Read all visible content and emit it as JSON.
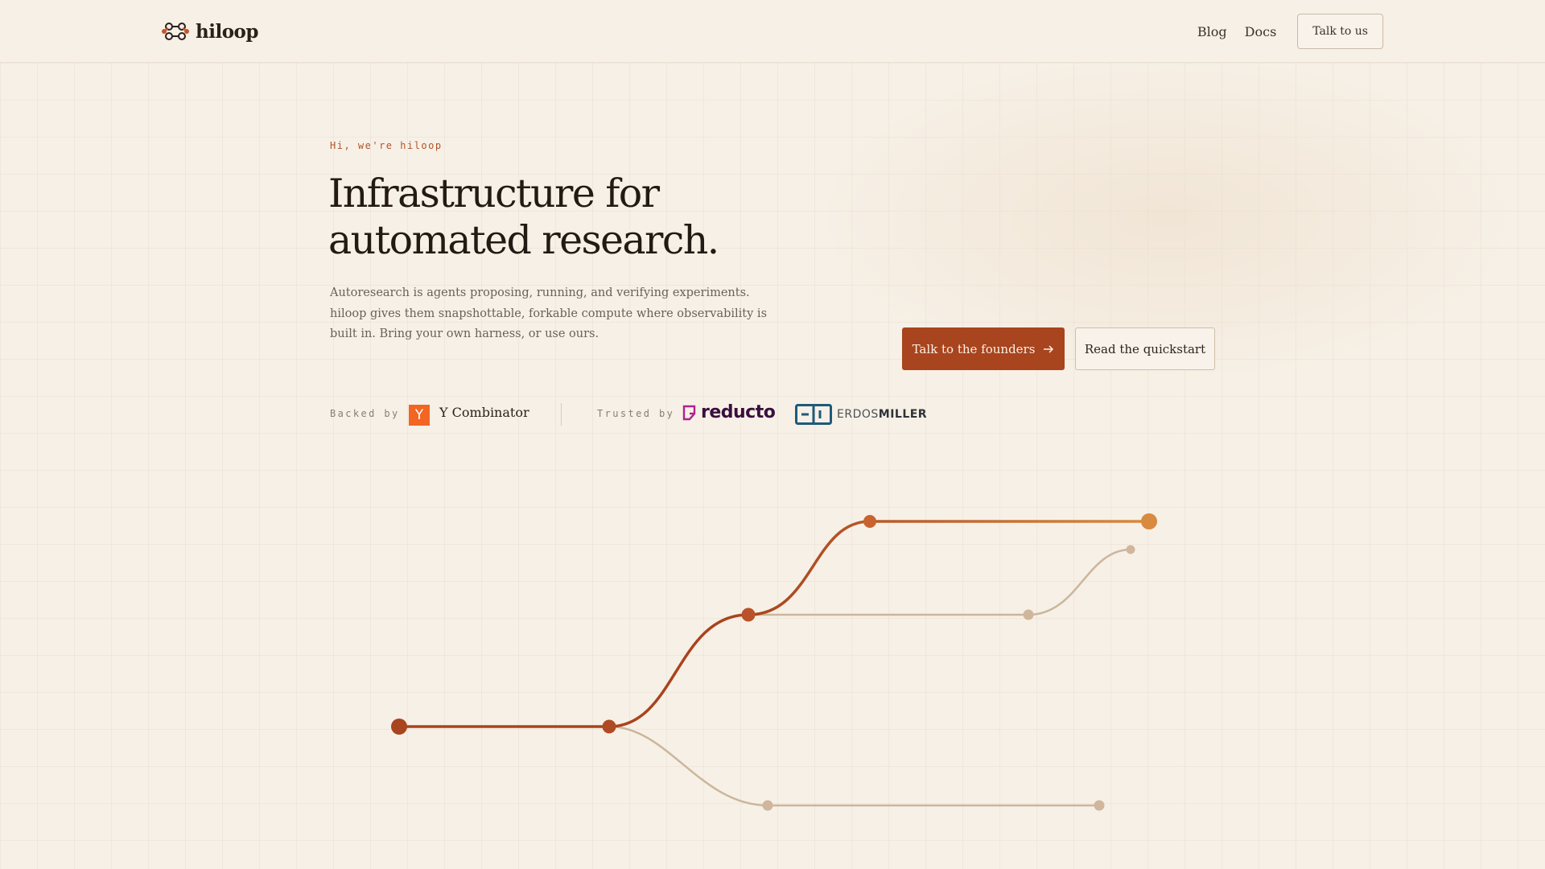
{
  "brand": {
    "name": "hiloop",
    "logo_icon": "molecule-icon"
  },
  "nav": {
    "links": [
      "Blog",
      "Docs"
    ],
    "cta": "Talk to us"
  },
  "hero": {
    "eyebrow": "Hi, we're hiloop",
    "title_line1": "Infrastructure for",
    "title_line2": "automated research.",
    "lede": "Autoresearch is agents proposing, running, and verifying experiments. hiloop gives them snapshottable, forkable compute where observability is built in. Bring your own harness, or use ours.",
    "primary_cta": "Talk to the founders",
    "primary_cta_icon": "arrow-right-icon",
    "secondary_cta": "Read the quickstart"
  },
  "social_proof": {
    "backed_label": "Backed by",
    "backer_logo_letter": "Y",
    "backer_name": "Y Combinator",
    "trusted_label": "Trusted by",
    "trusted_by": [
      {
        "name": "reducto",
        "icon": "reducto-logo-icon"
      },
      {
        "name_light": "ERDOS",
        "name_bold": "MILLER",
        "icon": "erdosmiller-logo-icon"
      }
    ]
  },
  "colors": {
    "background": "#f7f0e6",
    "accent": "#a8441e",
    "accent_light": "#d4843f",
    "branch_muted": "#c9b49a",
    "text": "#231a14",
    "muted_text": "#6b6058"
  }
}
